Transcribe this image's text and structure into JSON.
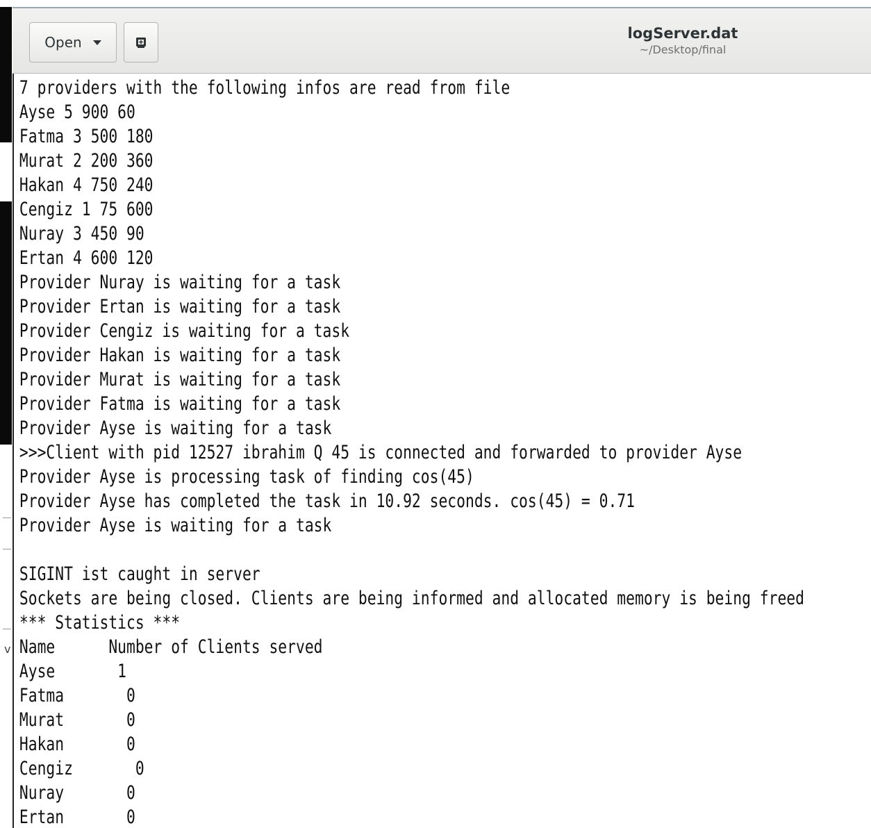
{
  "window": {
    "title": "logServer.dat",
    "subtitle": "~/Desktop/final"
  },
  "toolbar": {
    "open_label": "Open",
    "open_icon": "chevron-down-icon",
    "new_icon": "new-document-icon"
  },
  "desktop": {
    "edge_glyph": "v"
  },
  "editor": {
    "content": "7 providers with the following infos are read from file\nAyse 5 900 60\nFatma 3 500 180\nMurat 2 200 360\nHakan 4 750 240\nCengiz 1 75 600\nNuray 3 450 90\nErtan 4 600 120\nProvider Nuray is waiting for a task\nProvider Ertan is waiting for a task\nProvider Cengiz is waiting for a task\nProvider Hakan is waiting for a task\nProvider Murat is waiting for a task\nProvider Fatma is waiting for a task\nProvider Ayse is waiting for a task\n>>>Client with pid 12527 ibrahim Q 45 is connected and forwarded to provider Ayse\nProvider Ayse is processing task of finding cos(45)\nProvider Ayse has completed the task in 10.92 seconds. cos(45) = 0.71\nProvider Ayse is waiting for a task\n\nSIGINT ist caught in server\nSockets are being closed. Clients are being informed and allocated memory is being freed\n*** Statistics ***\nName      Number of Clients served\nAyse       1\nFatma       0\nMurat       0\nHakan       0\nCengiz       0\nNuray       0\nErtan       0"
  }
}
